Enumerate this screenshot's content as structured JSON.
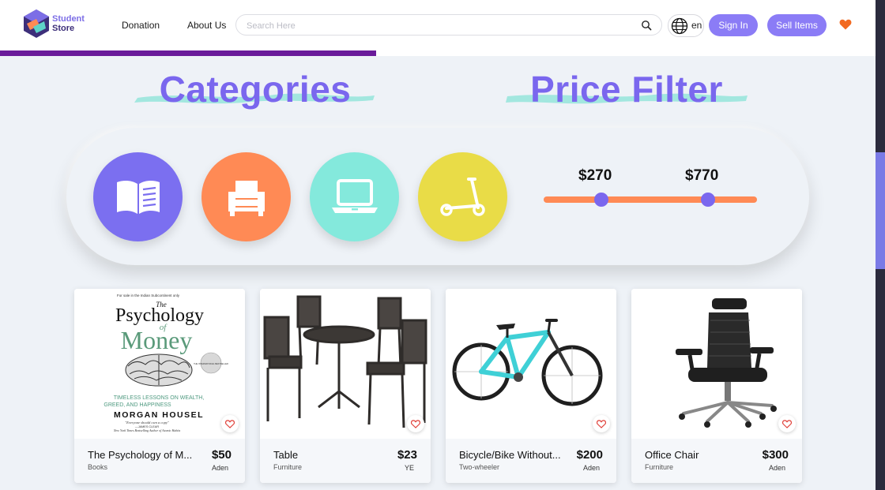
{
  "brand": {
    "line1": "Student",
    "line2": "Store"
  },
  "nav": {
    "donation": "Donation",
    "about": "About Us"
  },
  "search": {
    "placeholder": "Search Here",
    "value": ""
  },
  "language": {
    "code": "en"
  },
  "buttons": {
    "sign_in": "Sign In",
    "sell_items": "Sell Items"
  },
  "scroll_progress": 0.43,
  "sections": {
    "categories_title": "Categories",
    "price_filter_title": "Price Filter"
  },
  "categories": [
    {
      "icon": "book-icon",
      "color": "#7b6ff0"
    },
    {
      "icon": "armchair-icon",
      "color": "#ff8a55"
    },
    {
      "icon": "laptop-icon",
      "color": "#84e9dc"
    },
    {
      "icon": "scooter-icon",
      "color": "#e9dc47"
    }
  ],
  "price_filter": {
    "min_label": "$270",
    "max_label": "$770",
    "min_fraction": 0.27,
    "max_fraction": 0.77
  },
  "products": [
    {
      "title": "The Psychology of M...",
      "category": "Books",
      "price": "$50",
      "location": "Aden",
      "image": "book-cover"
    },
    {
      "title": "Table",
      "category": "Furniture",
      "price": "$23",
      "location": "YE",
      "image": "table-chairs"
    },
    {
      "title": "Bicycle/Bike Without...",
      "category": "Two-wheeler",
      "price": "$200",
      "location": "Aden",
      "image": "bicycle"
    },
    {
      "title": "Office Chair",
      "category": "Furniture",
      "price": "$300",
      "location": "Aden",
      "image": "office-chair"
    }
  ],
  "book_cover": {
    "top_note": "For sale in the Indian Subcontinent only",
    "the": "The",
    "psychology": "Psychology",
    "of": "of",
    "money": "Money",
    "badge": "THE INTERNATIONAL BESTSELLER",
    "subtitle1": "TIMELESS LESSONS ON WEALTH,",
    "subtitle2": "GREED, AND HAPPINESS",
    "author": "MORGAN HOUSEL",
    "quote": "\"Everyone should own a copy\"",
    "quote_author": "—JAMES CLEAR",
    "quote_note": "New York Times Bestselling Author of Atomic Habits"
  },
  "colors": {
    "accent": "#7a67ee",
    "button": "#8b7cf6",
    "heart": "#f26a21",
    "progress": "#6a1b9a",
    "slider": "#ff8a55"
  }
}
